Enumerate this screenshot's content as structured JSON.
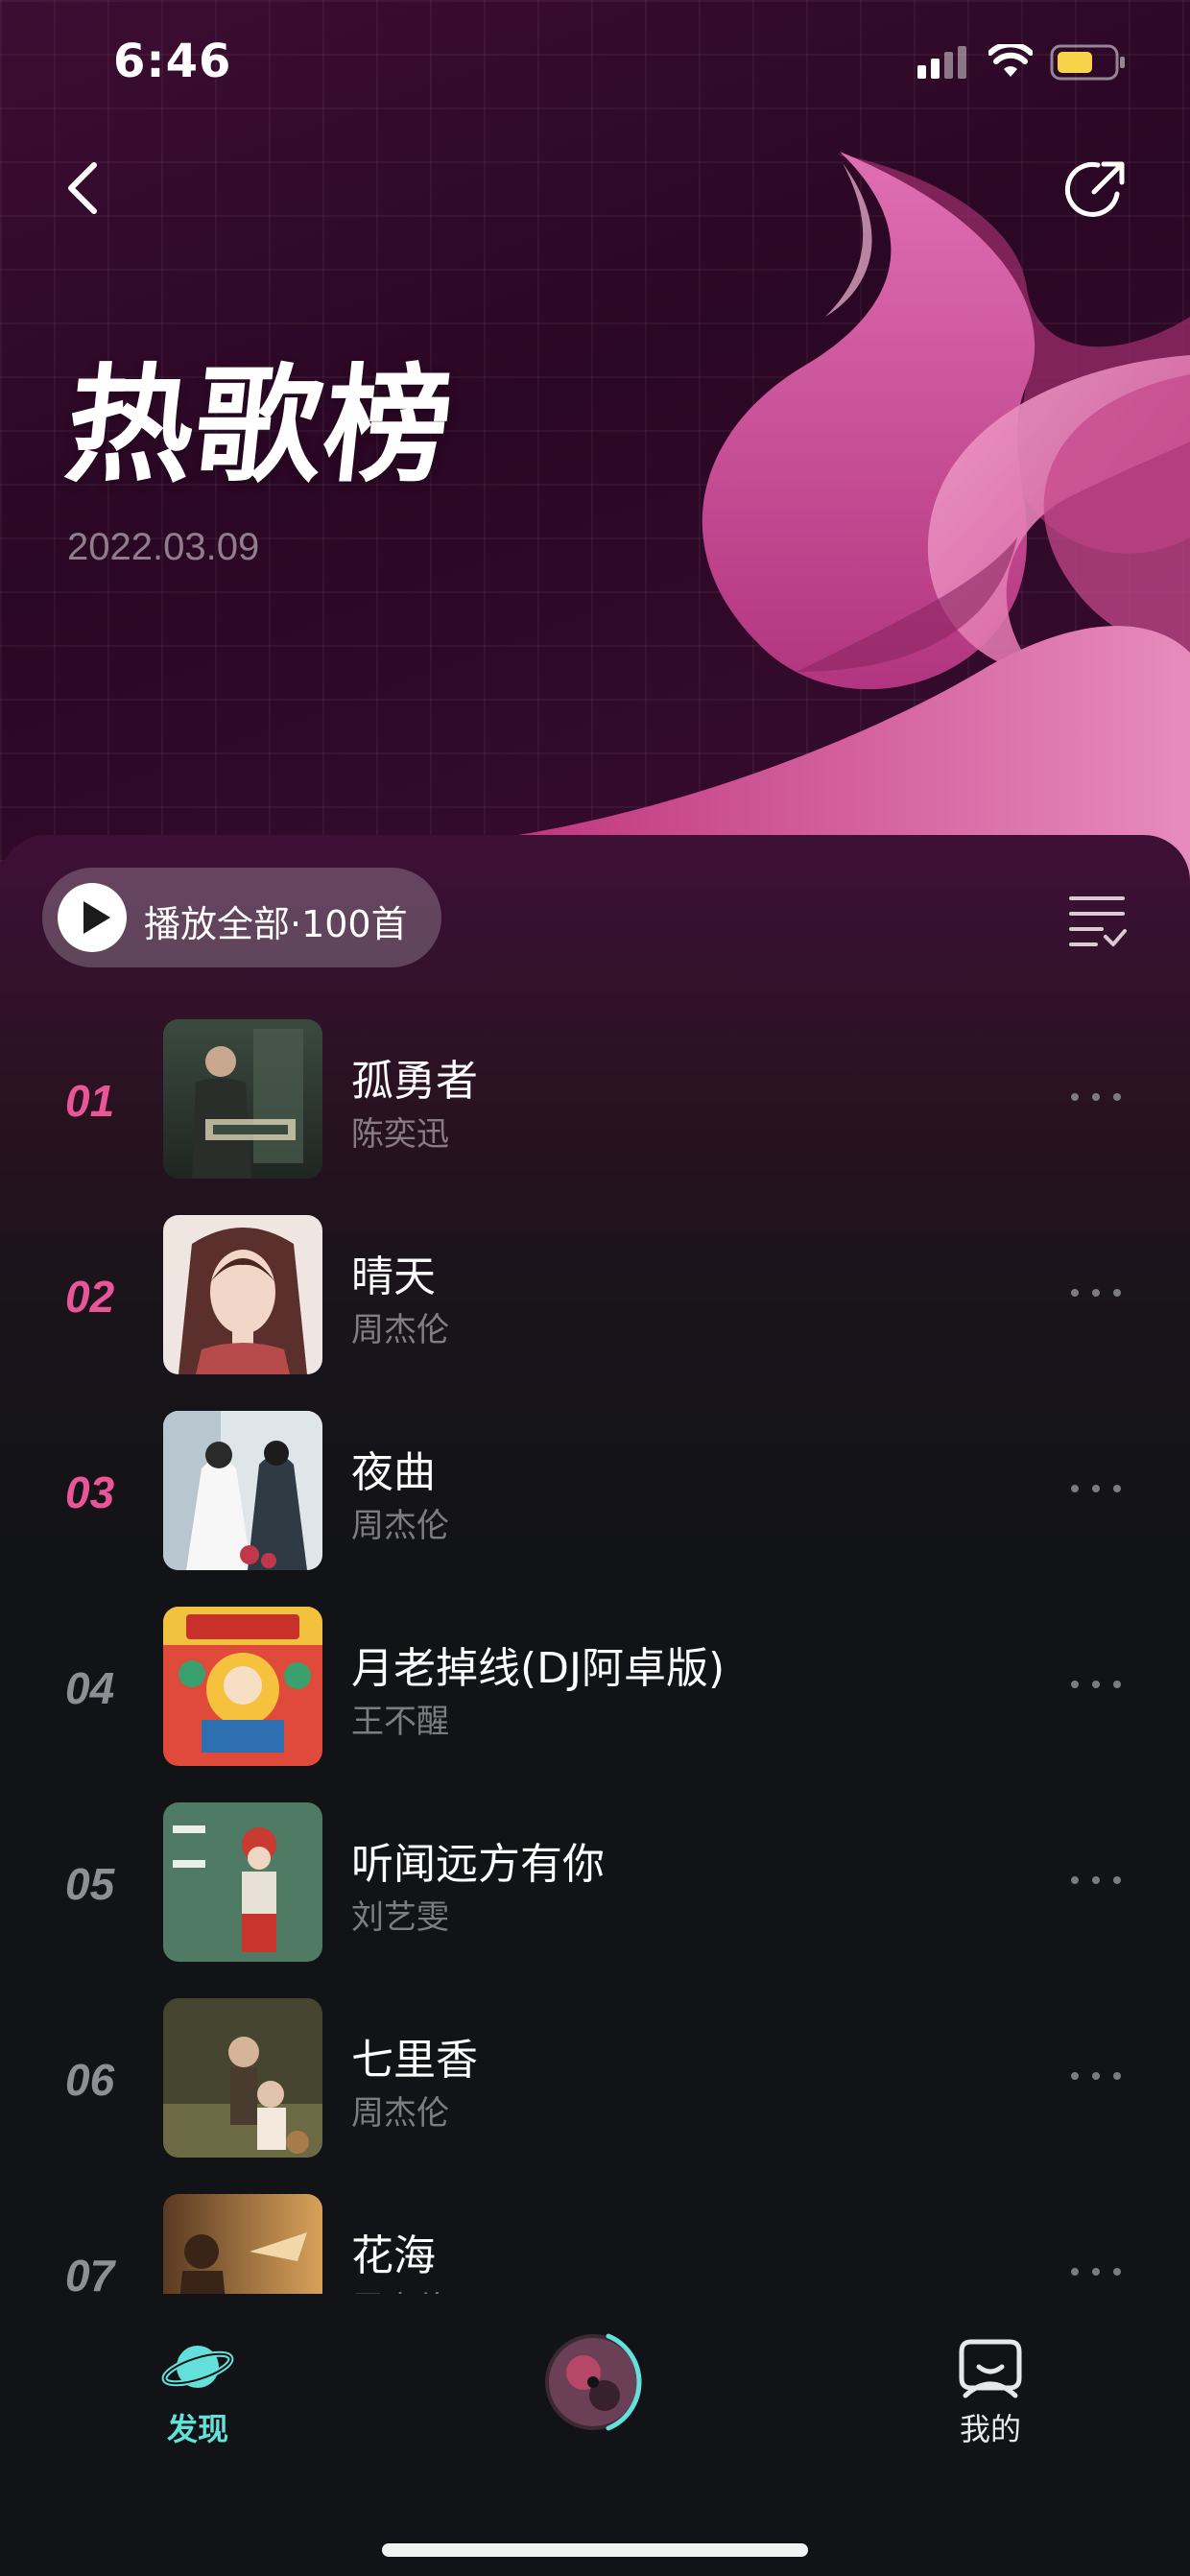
{
  "status_bar": {
    "time": "6:46"
  },
  "header": {
    "title": "热歌榜",
    "date": "2022.03.09",
    "back_icon": "chevron-left-icon",
    "share_icon": "share-icon"
  },
  "toolbar": {
    "play_all_label": "播放全部·100首",
    "sort_icon": "list-check-icon"
  },
  "songs": [
    {
      "rank": "01",
      "title": "孤勇者",
      "artist": "陈奕迅",
      "highlight": true
    },
    {
      "rank": "02",
      "title": "晴天",
      "artist": "周杰伦",
      "highlight": true
    },
    {
      "rank": "03",
      "title": "夜曲",
      "artist": "周杰伦",
      "highlight": true
    },
    {
      "rank": "04",
      "title": "月老掉线(DJ阿卓版)",
      "artist": "王不醒",
      "highlight": false
    },
    {
      "rank": "05",
      "title": "听闻远方有你",
      "artist": "刘艺雯",
      "highlight": false
    },
    {
      "rank": "06",
      "title": "七里香",
      "artist": "周杰伦",
      "highlight": false
    },
    {
      "rank": "07",
      "title": "花海",
      "artist": "周杰伦",
      "highlight": false
    }
  ],
  "tab_bar": {
    "discover_label": "发现",
    "mine_label": "我的"
  },
  "colors": {
    "accent_pink": "#ea5597",
    "accent_teal": "#62e0d9",
    "rank_grey": "#8d8f95"
  }
}
